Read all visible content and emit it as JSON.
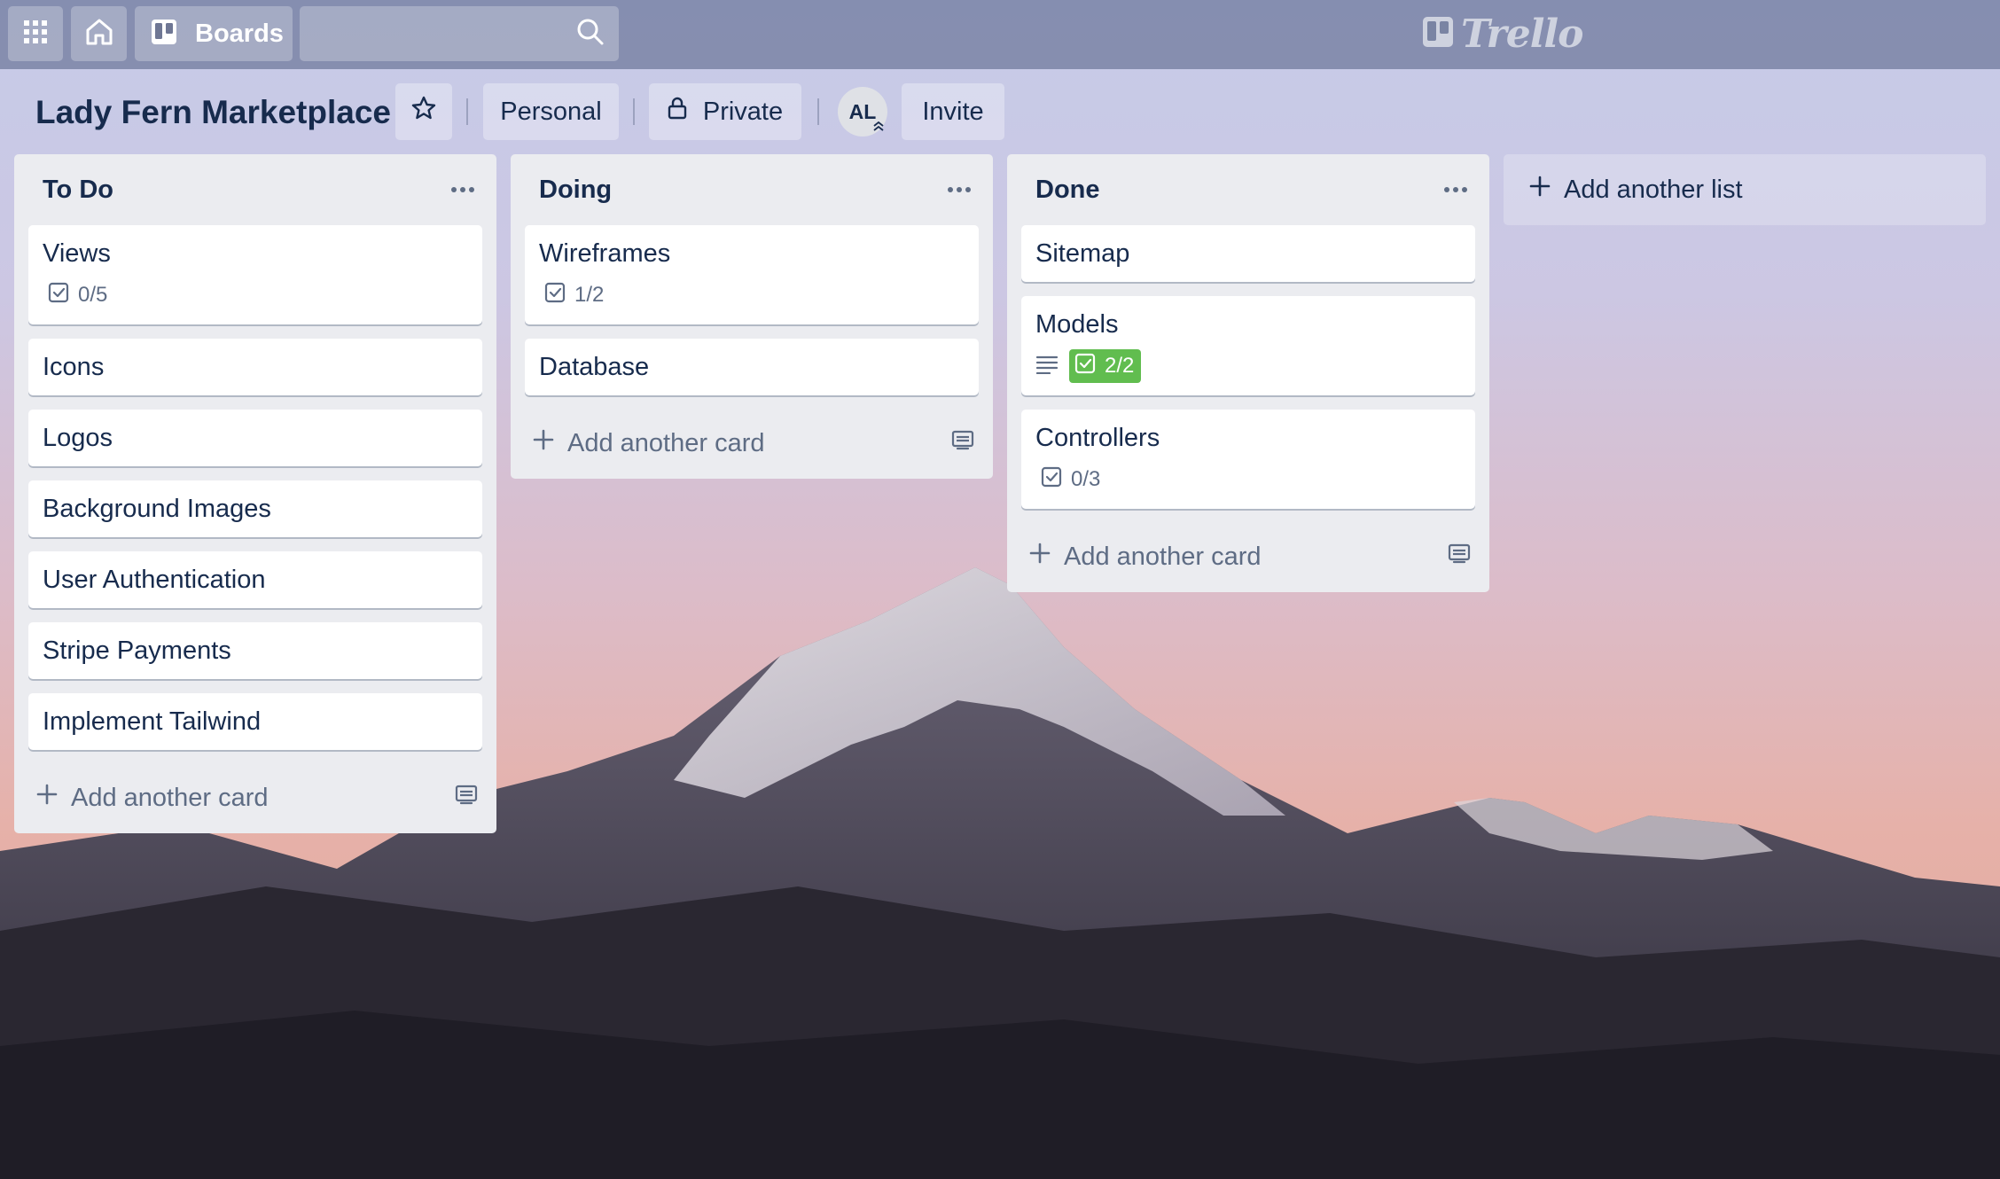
{
  "topbar": {
    "boards_label": "Boards",
    "search_value": "",
    "logo_text": "Trello"
  },
  "board": {
    "title": "Lady Fern Marketplace",
    "visibility_team": "Personal",
    "visibility_privacy": "Private",
    "member_initials": "AL",
    "invite_label": "Invite"
  },
  "lists": [
    {
      "title": "To Do",
      "cards": [
        {
          "title": "Views",
          "checklist": "0/5",
          "complete": false,
          "description": false
        },
        {
          "title": "Icons"
        },
        {
          "title": "Logos"
        },
        {
          "title": "Background Images"
        },
        {
          "title": "User Authentication"
        },
        {
          "title": "Stripe Payments"
        },
        {
          "title": "Implement Tailwind"
        }
      ],
      "add_card_label": "Add another card"
    },
    {
      "title": "Doing",
      "cards": [
        {
          "title": "Wireframes",
          "checklist": "1/2",
          "complete": false,
          "description": false
        },
        {
          "title": "Database"
        }
      ],
      "add_card_label": "Add another card"
    },
    {
      "title": "Done",
      "cards": [
        {
          "title": "Sitemap"
        },
        {
          "title": "Models",
          "checklist": "2/2",
          "complete": true,
          "description": true
        },
        {
          "title": "Controllers",
          "checklist": "0/3",
          "complete": false,
          "description": false
        }
      ],
      "add_card_label": "Add another card"
    }
  ],
  "add_list_label": "Add another list",
  "colors": {
    "list_bg": "#ebecf0",
    "text": "#172b4d",
    "muted": "#5e6c84",
    "complete_green": "#61bd4f"
  },
  "icons": [
    "apps-grid-icon",
    "home-icon",
    "boards-icon",
    "search-icon",
    "trello-logo-icon",
    "star-icon",
    "lock-icon",
    "ellipsis-icon",
    "plus-icon",
    "card-template-icon",
    "checklist-icon",
    "description-icon"
  ]
}
